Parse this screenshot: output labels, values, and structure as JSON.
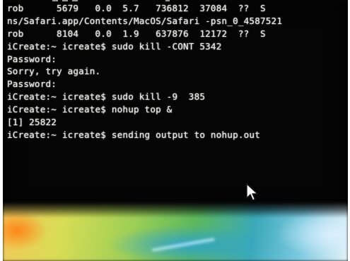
{
  "terminal": {
    "lines": [
      "rob      5679   0.0  5.7   736812  37084  ??  S",
      "ns/Safari.app/Contents/MacOS/Safari -psn_0_4587521",
      "rob      8104   0.0  1.9   637876  12172  ??  S",
      "iCreate:~ icreate$ sudo kill -CONT 5342",
      "Password:",
      "Sorry, try again.",
      "Password:",
      "iCreate:~ icreate$ sudo kill -9  385",
      "iCreate:~ icreate$ nohup top &",
      "[1] 25822",
      "iCreate:~ icreate$ sending output to nohup.out"
    ]
  },
  "colors": {
    "terminal_background": "#050506",
    "terminal_text": "#ebebe6",
    "cursor_fill": "#ffffff",
    "cursor_stroke": "#1a1a1a"
  },
  "icons": {
    "mouse_cursor": "arrow-pointer-icon"
  }
}
